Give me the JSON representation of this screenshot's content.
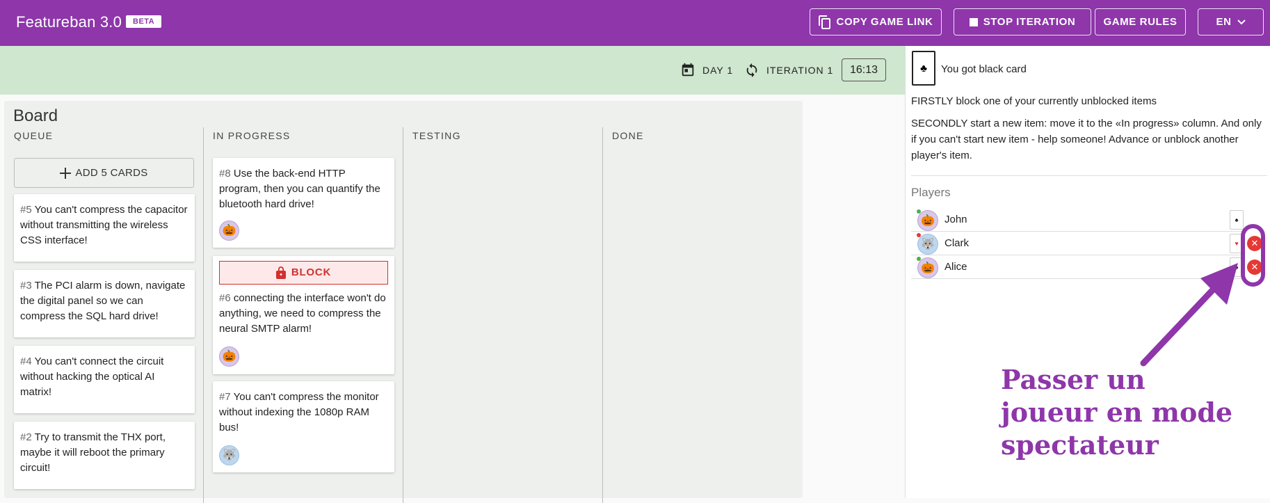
{
  "app": {
    "title": "Featureban 3.0",
    "badge": "BETA"
  },
  "toolbar": {
    "copy_link": "COPY GAME LINK",
    "stop_iteration": "STOP ITERATION",
    "game_rules": "GAME RULES",
    "language": "EN"
  },
  "status": {
    "day": "DAY 1",
    "iteration": "ITERATION 1",
    "timer": "16:13"
  },
  "board": {
    "title": "Board",
    "columns": [
      "QUEUE",
      "IN PROGRESS",
      "TESTING",
      "DONE"
    ],
    "add_button": "ADD 5 CARDS",
    "block_label": "BLOCK",
    "queue_cards": [
      {
        "num": "#5",
        "text": "You can't compress the capacitor without transmitting the wireless CSS interface!"
      },
      {
        "num": "#3",
        "text": "The PCI alarm is down, navigate the digital panel so we can compress the SQL hard drive!"
      },
      {
        "num": "#4",
        "text": "You can't connect the circuit without hacking the optical AI matrix!"
      },
      {
        "num": "#2",
        "text": "Try to transmit the THX port, maybe it will reboot the primary circuit!"
      }
    ],
    "progress_cards": [
      {
        "num": "#8",
        "text": "Use the back-end HTTP program, then you can quantify the bluetooth hard drive!",
        "avatar": "🎃"
      },
      {
        "num": "#6",
        "text": "connecting the interface won't do anything, we need to compress the neural SMTP alarm!",
        "avatar": "🎃"
      },
      {
        "num": "#7",
        "text": "You can't compress the monitor without indexing the 1080p RAM bus!",
        "avatar": "🐺"
      }
    ]
  },
  "side": {
    "card_message": "You got black card",
    "card_suit": "♣",
    "instruction_1": "FIRSTLY block one of your currently unblocked items",
    "instruction_2": "SECONDLY start a new item: move it to the «In progress» column. And only if you can't start new item - help someone! Advance or unblock another player's item.",
    "players_heading": "Players",
    "players": [
      {
        "name": "John",
        "avatar": "🎃",
        "status_color": "#4caf50",
        "card": "♠"
      },
      {
        "name": "Clark",
        "avatar": "🐺",
        "status_color": "#e53935",
        "card": "♥"
      },
      {
        "name": "Alice",
        "avatar": "🎃",
        "status_color": "#4caf50",
        "card": "♠"
      }
    ]
  },
  "annotation": {
    "line1": "Passer un",
    "line2": "joueur en mode",
    "line3": "spectateur",
    "color": "#8e36aa"
  },
  "colors": {
    "primary": "#8e36aa",
    "status_bar": "#cfe6cf",
    "danger": "#d32f2f"
  }
}
